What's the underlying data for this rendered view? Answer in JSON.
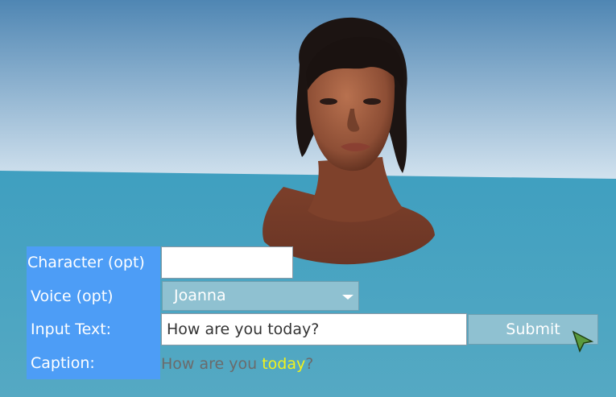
{
  "form": {
    "character_label": "Character (opt)",
    "character_value": "",
    "voice_label": "Voice (opt)",
    "voice_selected": "Joanna",
    "input_label": "Input Text:",
    "input_value": "How are you today?",
    "submit_label": "Submit",
    "caption_label": "Caption:",
    "caption": {
      "before": "How are you ",
      "highlight": "today",
      "after": "?"
    }
  },
  "colors": {
    "label_panel": "#4d9df6",
    "caption_highlight": "#f2f21a",
    "sea": "#4aa3bf",
    "sky_top": "#4f86b3",
    "sky_bottom": "#d3e3ef"
  },
  "icons": {
    "cursor": "mouse-pointer-icon",
    "dropdown": "chevron-down-icon"
  }
}
